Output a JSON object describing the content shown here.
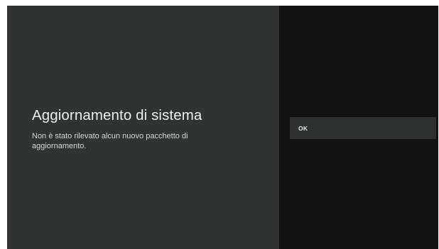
{
  "dialog": {
    "title": "Aggiornamento di sistema",
    "message": "Non è stato rilevato alcun nuovo pacchetto di aggiornamento."
  },
  "actions": {
    "ok_label": "OK"
  },
  "colors": {
    "left_pane": "#313232",
    "right_pane": "#121212",
    "selected_action": "#2f3030",
    "text_primary": "#eceeee"
  }
}
